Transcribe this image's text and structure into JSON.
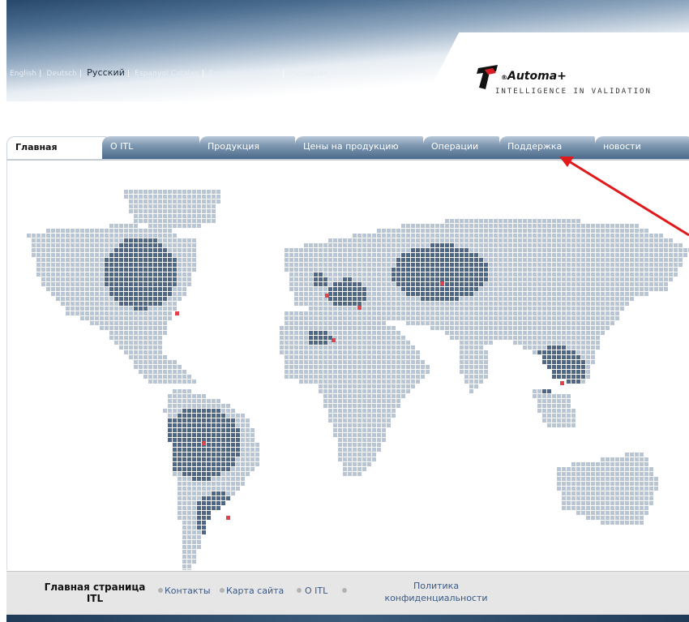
{
  "languages": [
    {
      "label": "English",
      "active": false
    },
    {
      "label": "Deutsch",
      "active": false
    },
    {
      "label": "Русский",
      "active": true
    },
    {
      "label": "Espanyol Catalan",
      "active": false
    },
    {
      "label": "Español Castellano",
      "active": false
    },
    {
      "label": "Português",
      "active": false
    }
  ],
  "logo": {
    "wordmark": "Automa+",
    "registered": "®",
    "tagline": "INTELLIGENCE IN VALIDATION"
  },
  "tabs": [
    {
      "label": "Главная",
      "active": true
    },
    {
      "label": "О ITL",
      "active": false
    },
    {
      "label": "Продукция",
      "active": false
    },
    {
      "label": "Цены на продукцию",
      "active": false
    },
    {
      "label": "Операции",
      "active": false
    },
    {
      "label": "Поддержка",
      "active": false
    },
    {
      "label": "новости",
      "active": false
    }
  ],
  "footer": {
    "home_line1": "Главная страница",
    "home_line2": "ITL",
    "contacts": "Контакты",
    "sitemap": "Карта сайта",
    "about": "О ITL",
    "policy_line1": "Политика",
    "policy_line2": "конфиденциальности"
  },
  "colors": {
    "tab_gradient_top": "#b9c9d9",
    "tab_gradient_bottom": "#4b6a8b",
    "map_light": "#b7c6d6",
    "map_dark": "#4d6788",
    "map_marker": "#e0434b",
    "annotation_arrow": "#e0191b",
    "footer_link": "#3a5a86"
  }
}
